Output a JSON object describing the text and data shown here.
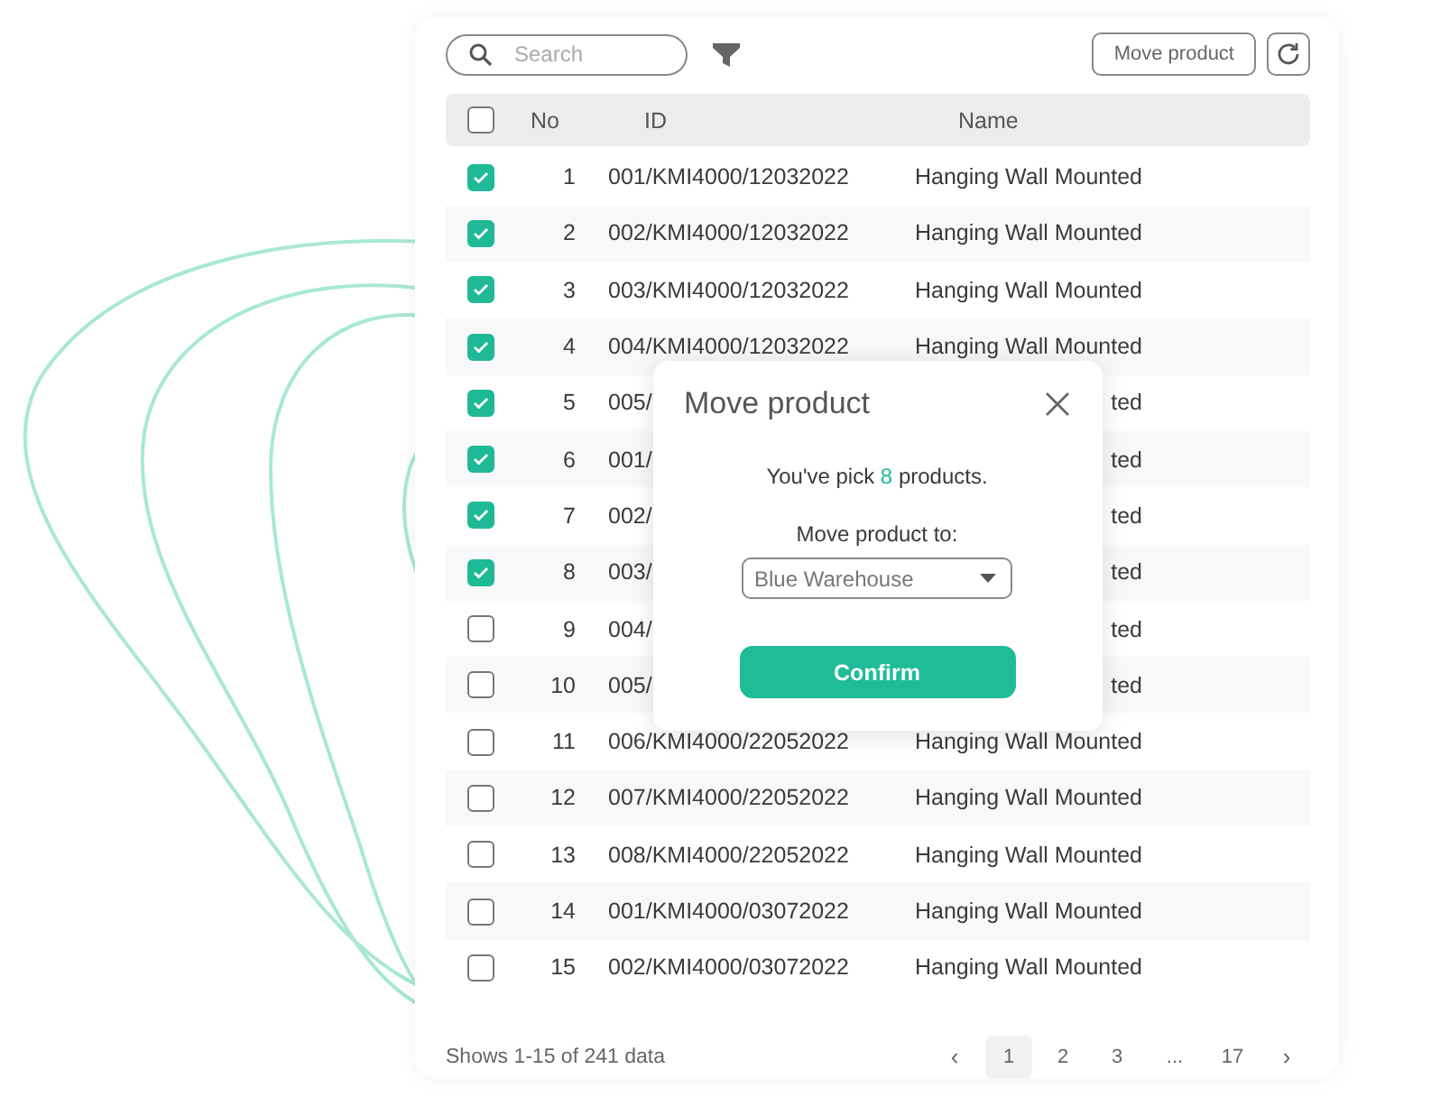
{
  "toolbar": {
    "search": {
      "placeholder": "Search"
    },
    "move_button": "Move product"
  },
  "table": {
    "header_checked": false,
    "columns": [
      "No",
      "ID",
      "Name"
    ],
    "rows": [
      {
        "checked": true,
        "no": "1",
        "id": "001/KMI4000/12032022",
        "name": "Hanging Wall Mounted"
      },
      {
        "checked": true,
        "no": "2",
        "id": "002/KMI4000/12032022",
        "name": "Hanging Wall Mounted"
      },
      {
        "checked": true,
        "no": "3",
        "id": "003/KMI4000/12032022",
        "name": "Hanging Wall Mounted"
      },
      {
        "checked": true,
        "no": "4",
        "id": "004/KMI4000/12032022",
        "name": "Hanging Wall Mounted"
      },
      {
        "checked": true,
        "no": "5",
        "id": "005/",
        "name": "ted"
      },
      {
        "checked": true,
        "no": "6",
        "id": "001/",
        "name": "ted"
      },
      {
        "checked": true,
        "no": "7",
        "id": "002/",
        "name": "ted"
      },
      {
        "checked": true,
        "no": "8",
        "id": "003/",
        "name": "ted"
      },
      {
        "checked": false,
        "no": "9",
        "id": "004/",
        "name": "ted"
      },
      {
        "checked": false,
        "no": "10",
        "id": "005/",
        "name": "ted"
      },
      {
        "checked": false,
        "no": "11",
        "id": "006/KMI4000/22052022",
        "name": "Hanging Wall Mounted"
      },
      {
        "checked": false,
        "no": "12",
        "id": "007/KMI4000/22052022",
        "name": "Hanging Wall Mounted"
      },
      {
        "checked": false,
        "no": "13",
        "id": "008/KMI4000/22052022",
        "name": "Hanging Wall Mounted"
      },
      {
        "checked": false,
        "no": "14",
        "id": "001/KMI4000/03072022",
        "name": "Hanging Wall Mounted"
      },
      {
        "checked": false,
        "no": "15",
        "id": "002/KMI4000/03072022",
        "name": "Hanging Wall Mounted"
      }
    ]
  },
  "footer": {
    "summary": "Shows 1-15 of 241 data",
    "pages": [
      {
        "kind": "prev",
        "label": "‹"
      },
      {
        "kind": "page",
        "label": "1",
        "selected": true
      },
      {
        "kind": "page",
        "label": "2",
        "selected": false
      },
      {
        "kind": "page",
        "label": "3",
        "selected": false
      },
      {
        "kind": "gap",
        "label": "..."
      },
      {
        "kind": "page",
        "label": "17",
        "selected": false
      },
      {
        "kind": "next",
        "label": "›"
      }
    ]
  },
  "dialog": {
    "title": "Move product",
    "message_parts": [
      "You've pick ",
      "8",
      " products."
    ],
    "field_label": "Move product to:",
    "select_value": "Blue Warehouse",
    "confirm": "Confirm"
  }
}
